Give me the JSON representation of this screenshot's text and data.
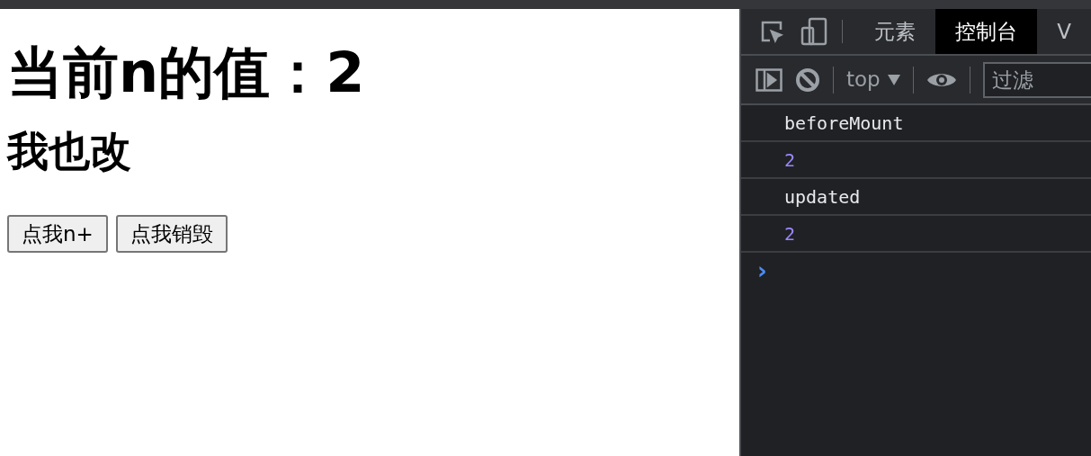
{
  "page": {
    "heading": "当前n的值：2",
    "subheading": "我也改",
    "buttons": [
      "点我n+",
      "点我销毁"
    ]
  },
  "devtools": {
    "tabs": [
      {
        "label": "元素",
        "selected": false
      },
      {
        "label": "控制台",
        "selected": true
      },
      {
        "label": "V",
        "selected": false
      }
    ],
    "context": "top",
    "filter": {
      "placeholder": "过滤"
    },
    "messages": [
      {
        "kind": "text",
        "text": "beforeMount"
      },
      {
        "kind": "number",
        "text": "2"
      },
      {
        "kind": "text",
        "text": "updated"
      },
      {
        "kind": "number",
        "text": "2"
      }
    ],
    "prompt": "›"
  }
}
